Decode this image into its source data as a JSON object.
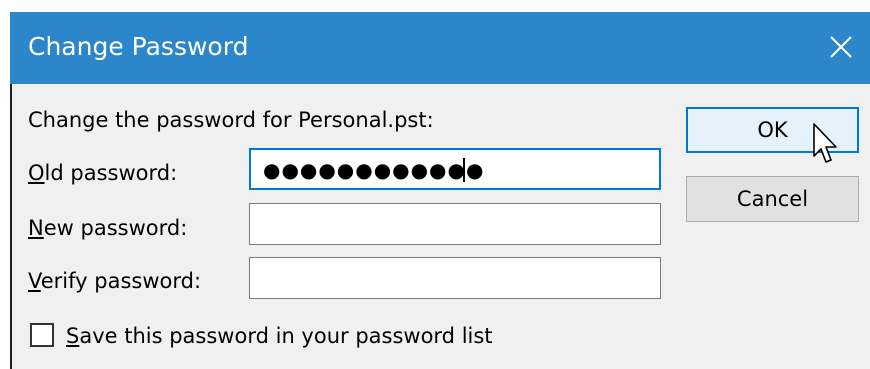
{
  "window": {
    "title": "Change Password",
    "close_icon": "close-icon"
  },
  "prompt_text": "Change the password for Personal.pst:",
  "fields": {
    "old_password": {
      "label_mnemonic": "O",
      "label_rest": "ld password:",
      "masked_value": "●●●●●●●●●●●●"
    },
    "new_password": {
      "label_mnemonic": "N",
      "label_rest": "ew password:",
      "masked_value": ""
    },
    "verify_password": {
      "label_mnemonic": "V",
      "label_rest": "erify password:",
      "masked_value": ""
    }
  },
  "buttons": {
    "ok": "OK",
    "cancel": "Cancel"
  },
  "save_checkbox": {
    "label_mnemonic": "S",
    "label_rest": "ave this password in your password list",
    "checked": false
  },
  "colors": {
    "titlebar": "#2b87c9",
    "focus_accent": "#0078d7",
    "dialog_bg": "#f0f0f0"
  }
}
